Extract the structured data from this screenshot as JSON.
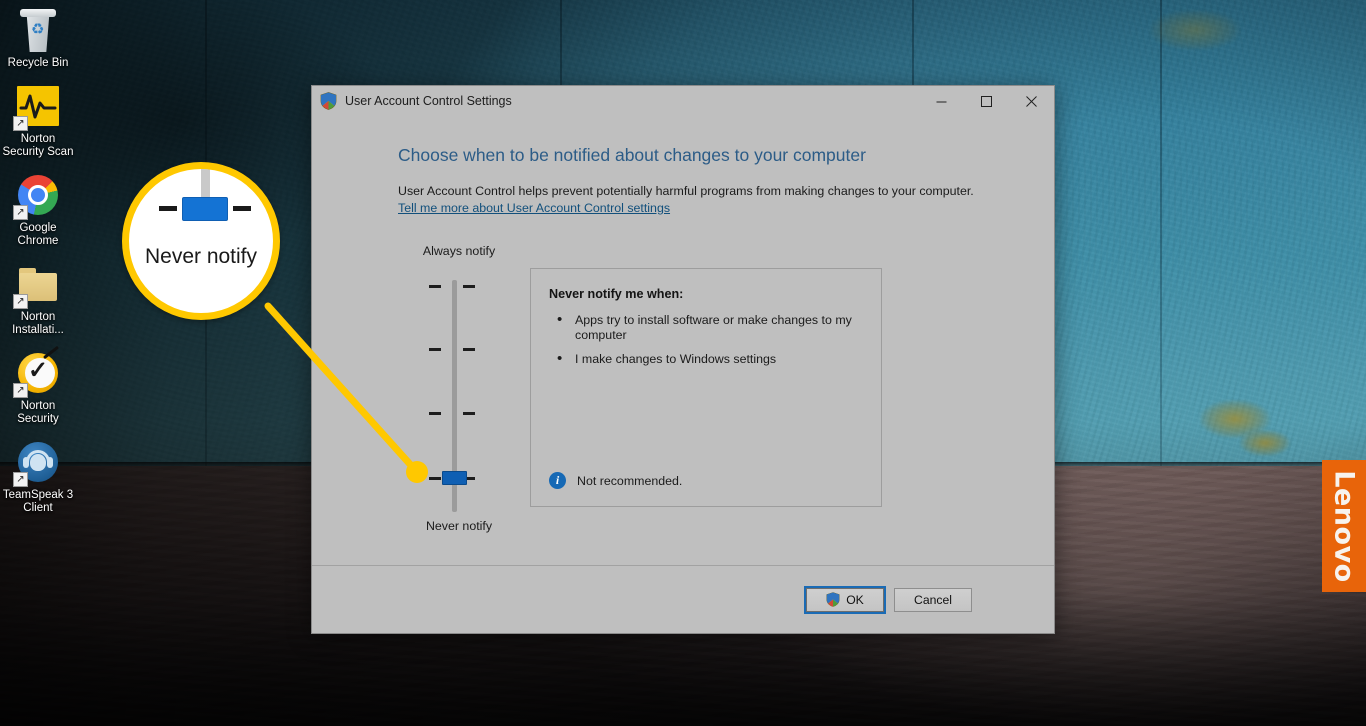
{
  "desktop": {
    "icons": [
      {
        "label": "Recycle Bin",
        "icon": "recycle-bin-icon"
      },
      {
        "label": "Norton Security Scan",
        "icon": "norton-security-scan-icon"
      },
      {
        "label": "Google Chrome",
        "icon": "google-chrome-icon"
      },
      {
        "label": "Norton Installati...",
        "icon": "folder-icon"
      },
      {
        "label": "Norton Security",
        "icon": "norton-security-icon"
      },
      {
        "label": "TeamSpeak 3 Client",
        "icon": "teamspeak-icon"
      }
    ],
    "branding": {
      "lenovo_label": "Lenovo",
      "lenovo_color": "#e8640a"
    },
    "wallpaper_colors": {
      "wall": "#3f8fa8",
      "floor": "#4d3f40"
    }
  },
  "dialog": {
    "title": "User Account Control Settings",
    "title_icon": "uac-shield-icon",
    "window_controls": {
      "minimize": "—",
      "maximize": "☐",
      "close": "✕"
    },
    "heading": "Choose when to be notified about changes to your computer",
    "description": "User Account Control helps prevent potentially harmful programs from making changes to your computer.",
    "link": "Tell me more about User Account Control settings",
    "slider": {
      "top_label": "Always notify",
      "bottom_label": "Never notify",
      "levels": 4,
      "current_level": 1,
      "current_value": "Never notify",
      "thumb_color": "#0f5fb3"
    },
    "info_panel": {
      "title": "Never notify me when:",
      "bullets": [
        "Apps try to install software or make changes to my computer",
        "I make changes to Windows settings"
      ],
      "footer_icon": "info-icon",
      "footer_text": "Not recommended."
    },
    "footer": {
      "ok_label": "OK",
      "ok_icon": "uac-shield-icon",
      "cancel_label": "Cancel",
      "focus_color": "#1a6bb5"
    },
    "colors": {
      "background": "#bfbfbf",
      "heading": "#2c5c87",
      "link": "#12507c"
    }
  },
  "callout": {
    "magnified_text": "Never notify",
    "accent_color": "#ffc800"
  }
}
